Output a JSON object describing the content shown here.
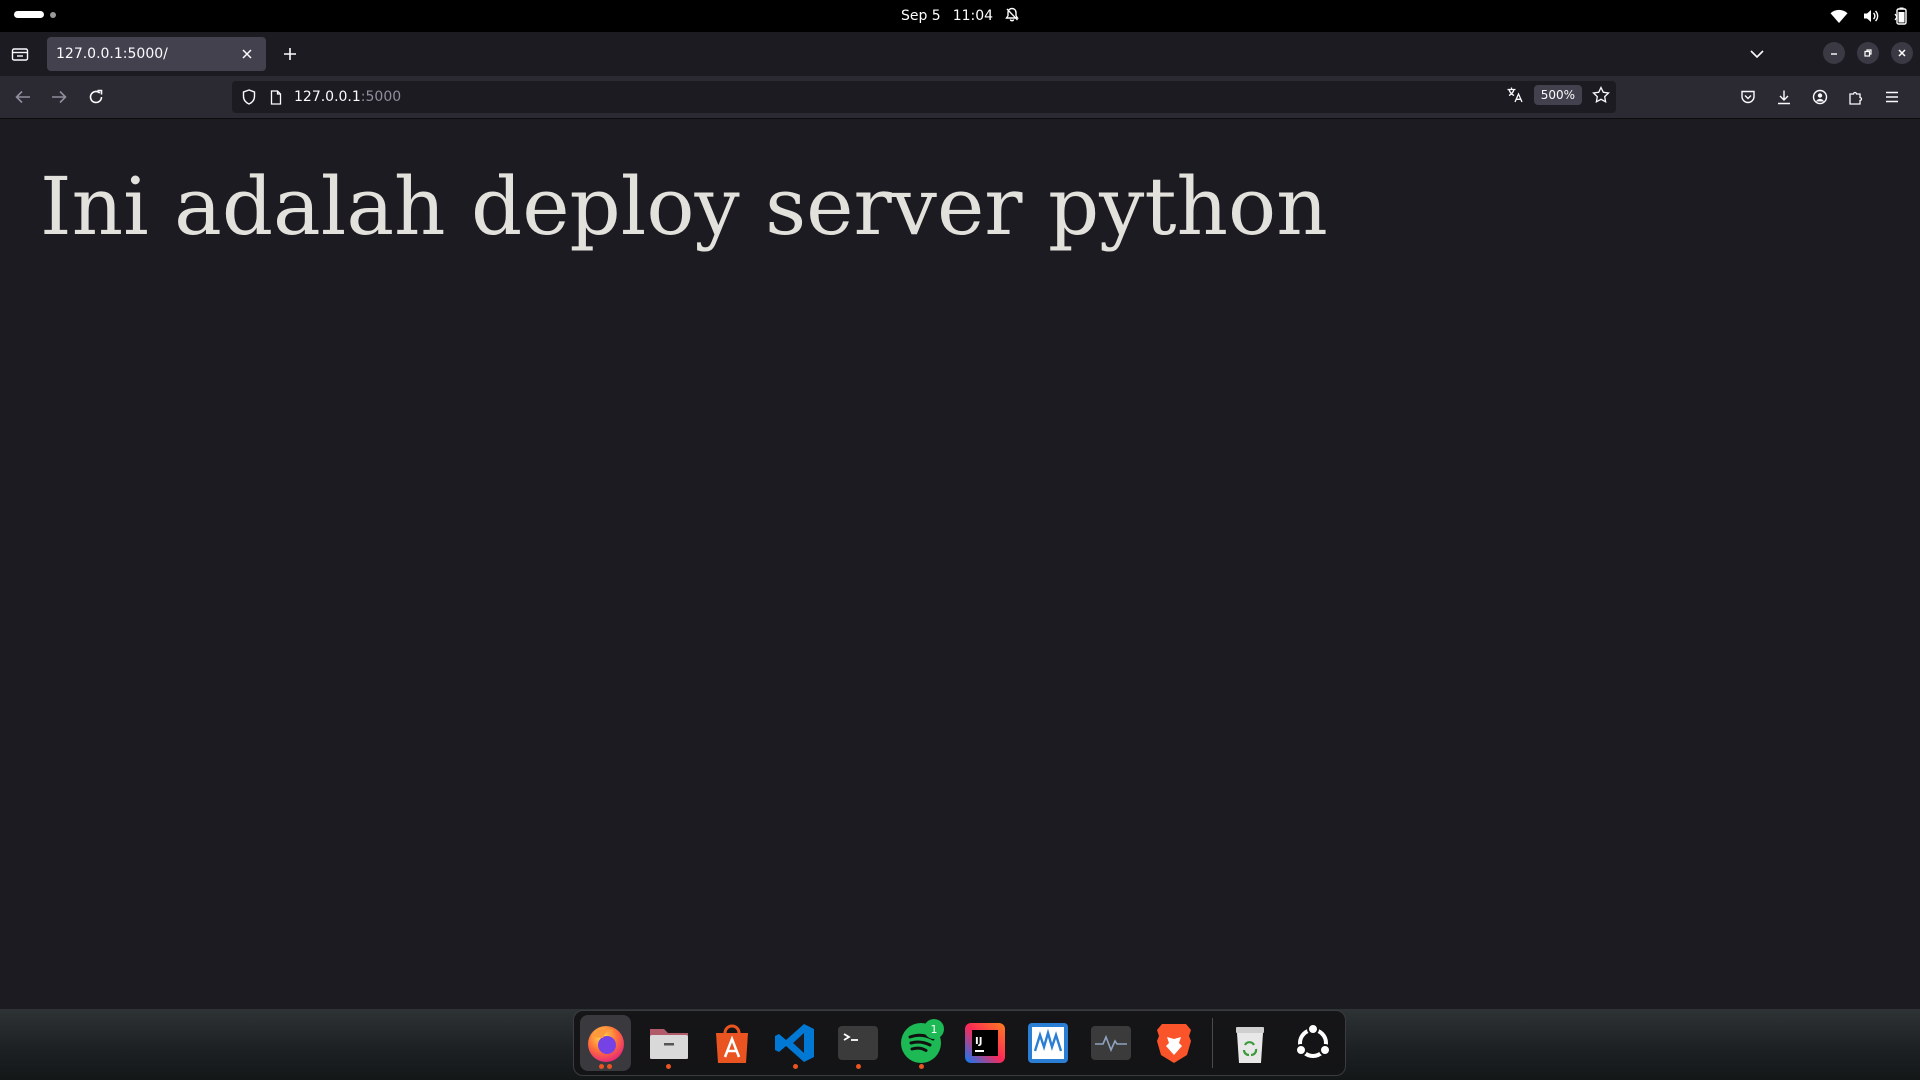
{
  "system_bar": {
    "date": "Sep 5",
    "time": "11:04"
  },
  "browser": {
    "tab": {
      "title": "127.0.0.1:5000/"
    },
    "url": {
      "host": "127.0.0.1",
      "port": ":5000"
    },
    "zoom": "500%"
  },
  "page": {
    "heading": "Ini adalah deploy server python"
  },
  "dock": {
    "items": [
      {
        "icon": "firefox-icon",
        "running": true,
        "active": true
      },
      {
        "icon": "files-icon",
        "running": true
      },
      {
        "icon": "app-center-icon",
        "running": false
      },
      {
        "icon": "vscode-icon",
        "running": true
      },
      {
        "icon": "terminal-icon",
        "running": true
      },
      {
        "icon": "spotify-icon",
        "running": true,
        "badge": "1"
      },
      {
        "icon": "intellij-icon",
        "running": false
      },
      {
        "icon": "mysql-workbench-icon",
        "running": false
      },
      {
        "icon": "system-monitor-icon",
        "running": false
      },
      {
        "icon": "brave-icon",
        "running": false
      },
      {
        "icon": "trash-icon",
        "running": false
      },
      {
        "icon": "show-apps-icon",
        "running": false
      }
    ],
    "spotify_badge": "1"
  }
}
